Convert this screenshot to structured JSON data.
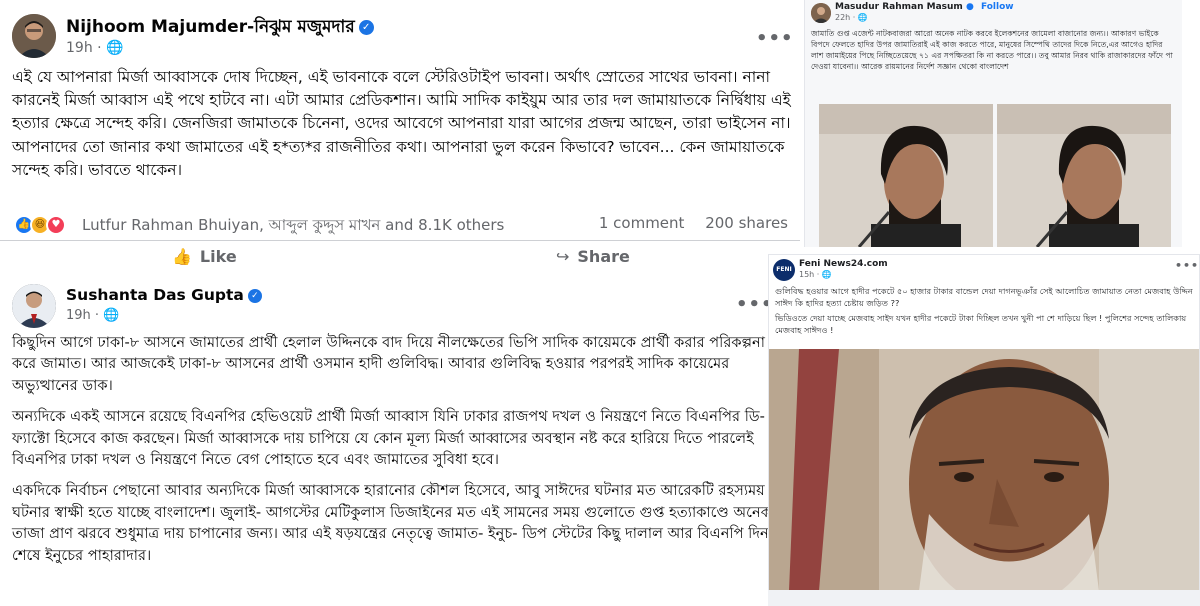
{
  "post1": {
    "author": "Nijhoom Majumder-নিঝুম মজুমদার",
    "time": "19h",
    "privacy_icon": "globe-icon",
    "more_icon": "more-dots-icon",
    "body": "এই যে আপনারা মির্জা আব্বাসকে দোষ দিচ্ছেন, এই ভাবনাকে বলে স্টেরিওটাইপ ভাবনা। অর্থাৎ স্রোতের সাথের ভাবনা। নানা কারনেই মির্জা আব্বাস এই পথে হাটবে না। এটা আমার প্রেডিকশান। আমি সাদিক কাইয়ুম আর তার দল জামায়াতকে নির্দ্বিধায় এই হত্যার ক্ষেত্রে সন্দেহ করি। জেনজিরা জামাতকে চিনেনা, ওদের আবেগে আপনারা যারা আগের প্রজন্ম আছেন, তারা ভাইসেন না। আপনাদের তো জানার কথা জামাতের এই হ*ত্য*র রাজনীতির কথা। আপনারা ভুল করেন কিভাবে? ভাবেন... কেন জামায়াতকে সন্দেহ করি। ভাবতে থাকেন।",
    "reactions_text": "Lutfur Rahman Bhuiyan, আব্দুল কুদ্দুস মাখন and 8.1K others",
    "comments": "1 comment",
    "shares": "200 shares",
    "like_label": "Like",
    "share_label": "Share"
  },
  "post2": {
    "author": "Sushanta Das Gupta",
    "time": "19h",
    "privacy_icon": "globe-icon",
    "more_icon": "more-dots-icon",
    "paragraphs": [
      "কিছুদিন আগে ঢাকা-৮ আসনে জামাতের প্রার্থী হেলাল উদ্দিনকে বাদ দিয়ে নীলক্ষেতের ভিপি সাদিক কায়েমকে প্রার্থী করার পরিকল্পনা করে জামাত। আর আজকেই ঢাকা-৮ আসনের প্রার্থী ওসমান হাদী গুলিবিদ্ধ। আবার গুলিবিদ্ধ হওয়ার পরপরই সাদিক কায়েমের অভ্যুত্থানের ডাক।",
      "অন্যদিকে একই আসনে রয়েছে বিএনপির হেভিওয়েট প্রার্থী মির্জা আব্বাস যিনি ঢাকার রাজপথ দখল ও নিয়ন্ত্রণে নিতে বিএনপির ডি- ফ্যাক্টো হিসেবে কাজ করছেন। মির্জা আব্বাসকে দায় চাপিয়ে যে কোন মূল্য মির্জা আব্বাসের অবস্থান নষ্ট করে হারিয়ে দিতে পারলেই বিএনপির ঢাকা দখল ও নিয়ন্ত্রণে নিতে বেগ পোহাতে হবে এবং জামাতের সুবিধা হবে।",
      "একদিকে নির্বাচন পেছানো আবার অন্যদিকে মির্জা আব্বাসকে হারানোর কৌশল হিসেবে, আবু সাঈদের ঘটনার মত আরেকটি রহস্যময় ঘটনার স্বাক্ষী হতে যাচ্ছে বাংলাদেশ। জুলাই- আগস্টের মেটিকুলাস ডিজাইনের মত এই সামনের সময় গুলোতে গুপ্ত হত্যাকাণ্ডে অনেক তাজা প্রাণ ঝরবে শুধুমাত্র দায় চাপানোর জন্য। আর এই ষড়যন্ত্রের নেতৃত্বে জামাত- ইনুচ- ডিপ স্টেটের কিছু দালাল আর বিএনপি দিন শেষে ইনুচের পাহারাদার।"
    ]
  },
  "masud": {
    "author": "Masudur Rahman Masum",
    "time": "22h",
    "follow": "Follow",
    "body": "জামাতি গুপ্ত এজেন্ট নাটকবাজরা আরো অনেক নাটক করবে ইলেকশনের জামেলা বাজানোর জন্য।। আকারণ ভাইকে বিপদে ফেলতে হাদির উপর জামাতিরাই এই কাজ করতে পারে, মানুষের সিম্পেথি তাদের দিকে নিতে,এর আগেও হাদির লাশ জামাইয়ের পিছে নিচ্ছিতেয়েছে ৭১ এর সপক্ষিতরা কি না করতে পারে।। তবু আমার নিরব থাকি রাজাকারদের ফাঁদে পা দেওয়া যাবেনা।। আরেক রায়মানের নির্দেশ সজ্ঞান থেকো বাংলাদেশ"
  },
  "feni": {
    "author": "Feni News24.com",
    "time": "15h",
    "avatar_text": "FENI",
    "paragraphs": [
      "গুলিবিদ্ধ হওয়ার আগে হাদীর পকেটে ৫০ হাজার টাকার বান্ডেল দেয়া দাগনভূঞাঁর সেই আলোচিত জামায়াত নেতা মেজবাহ উদ্দিন সাঈদ কি হাদির হত্যা চেষ্টায় জড়িত ??",
      "ভিডিওতে দেয়া যাচ্ছে মেজবাহ সাইদ যখন হাদীর পকেটে টাকা দিচ্ছিল তখন খুনী পা শে দাড়িয়ে ছিল ! পুলিশের সন্দেহ তালিকায় মেজবাহ সাঈদও !"
    ]
  },
  "colors": {
    "fb_blue": "#1877f2",
    "text_primary": "#050505",
    "text_secondary": "#65676b"
  }
}
